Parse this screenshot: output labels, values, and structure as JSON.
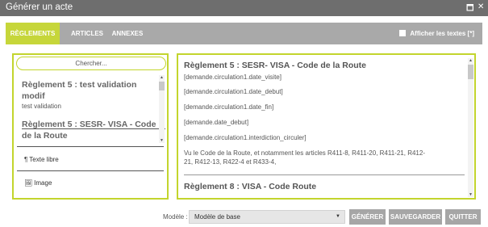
{
  "window": {
    "title": "Générer un acte",
    "maximize_glyph": "🗖",
    "close_glyph": "✕"
  },
  "tabs": [
    {
      "label": "RÈGLEMENTS",
      "active": true
    },
    {
      "label": "ARTICLES",
      "active": false
    },
    {
      "label": "ANNEXES",
      "active": false
    }
  ],
  "show_texts": {
    "label": "Afficher les textes [*]",
    "checked": false
  },
  "left_panel": {
    "search_placeholder": "Chercher...",
    "items": [
      {
        "title": "Règlement 5 : test validation modif",
        "subtitle": "test validation"
      },
      {
        "title": "Règlement 5 : SESR- VISA - Code de la Route",
        "subtitle": ""
      }
    ],
    "tools": [
      {
        "icon": "paragraph-icon",
        "glyph": "¶",
        "label": "Texte libre"
      },
      {
        "icon": "image-icon",
        "glyph": "🖼",
        "label": "Image"
      }
    ]
  },
  "right_panel": {
    "sections": [
      {
        "title": "Règlement 5 : SESR- VISA - Code de la Route",
        "lines": [
          "[demande.circulation1.date_visite]",
          "[demande.circulation1.date_debut]",
          "[demande.circulation1.date_fin]",
          "[demande.date_debut]",
          "[demande.circulation1.interdiction_circuler]",
          "Vu le Code de la Route, et notamment les articles R411-8, R411-20, R411-21, R412-21, R412-13, R422-4 et R433-4,"
        ]
      },
      {
        "title": "Règlement 8 : VISA - Code Route",
        "lines": []
      }
    ]
  },
  "footer": {
    "model_label": "Modèle :",
    "model_value": "Modèle de base",
    "buttons": {
      "generate": "GÉNÉRER",
      "save": "SAUVEGARDER",
      "quit": "QUITTER"
    }
  },
  "colors": {
    "accent": "#c6d63a",
    "tabbar": "#a9a9a9",
    "titlebar": "#6e6e6e",
    "button": "#a6a6a6"
  }
}
